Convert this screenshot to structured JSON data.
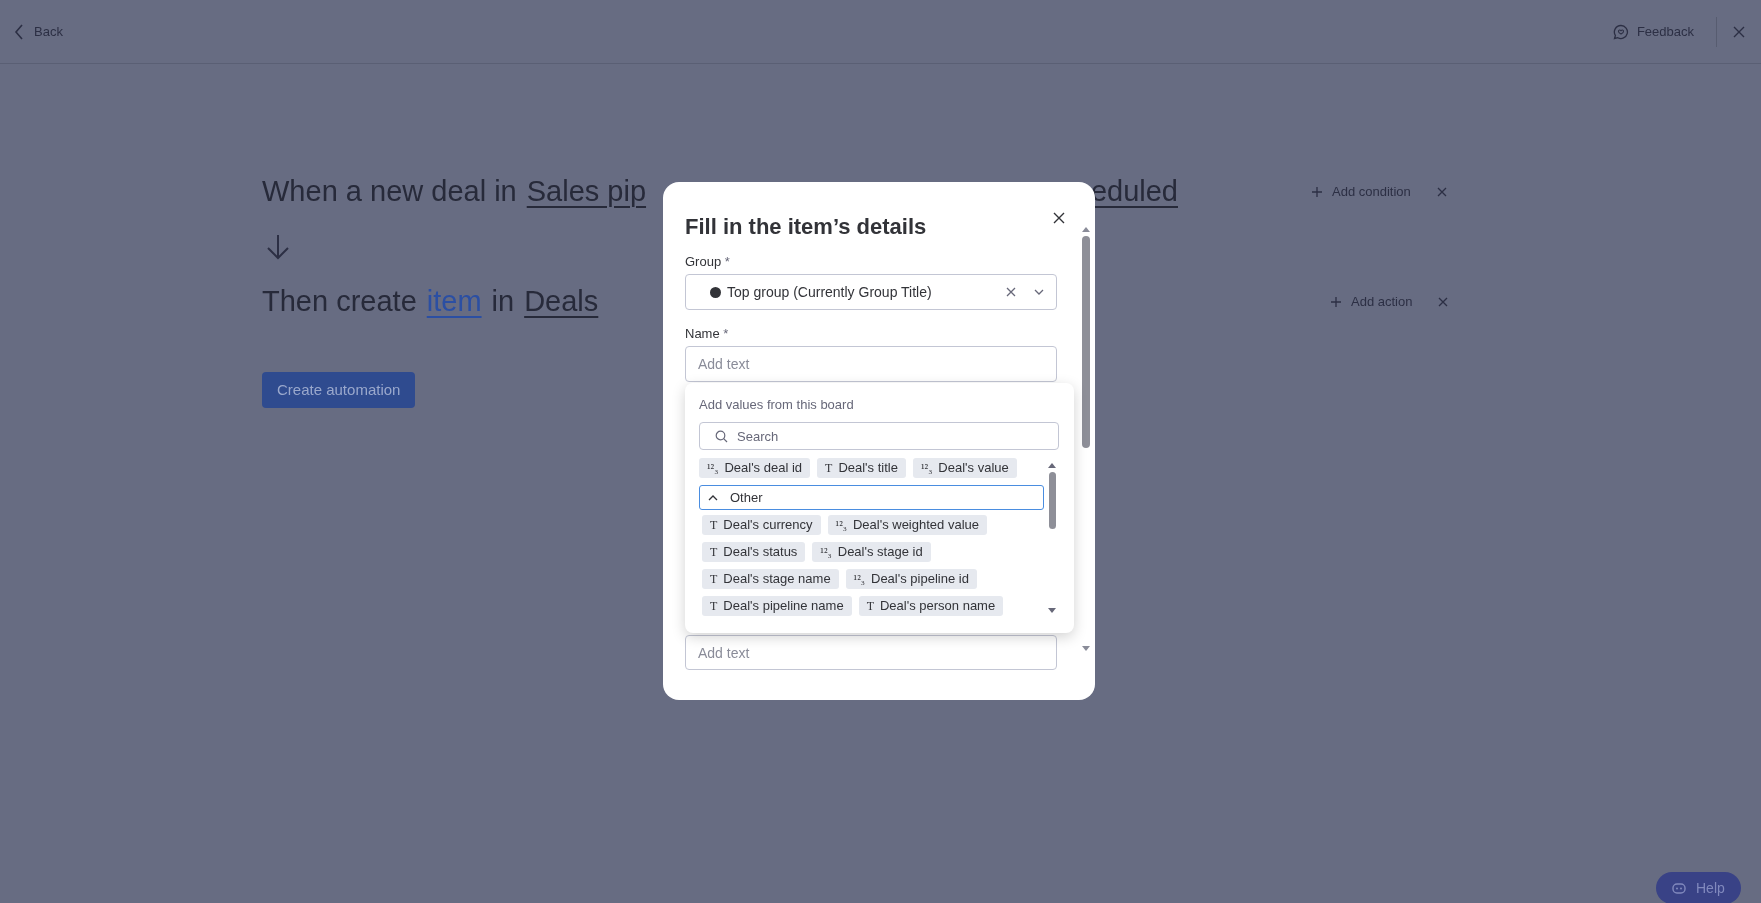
{
  "top_bar": {
    "back": "Back",
    "feedback": "Feedback"
  },
  "trigger": {
    "parts": [
      {
        "text": "When a new deal in",
        "kind": "plain"
      },
      {
        "text": "Sales pip",
        "kind": "field"
      },
      {
        "text": "eduled",
        "kind": "field"
      }
    ],
    "add": "Add condition"
  },
  "action": {
    "parts": [
      {
        "text": "Then create",
        "kind": "plain"
      },
      {
        "text": "item",
        "kind": "link"
      },
      {
        "text": "in",
        "kind": "plain"
      },
      {
        "text": "Deals",
        "kind": "field"
      }
    ],
    "add": "Add action"
  },
  "create_button": "Create automation",
  "modal": {
    "title": "Fill in the item’s details",
    "group": {
      "label": "Group",
      "required_mark": "*",
      "value": "Top group (Currently Group Title)"
    },
    "name": {
      "label": "Name",
      "required_mark": "*",
      "placeholder": "Add text"
    },
    "popover": {
      "heading": "Add values from this board",
      "search_placeholder": "Search",
      "chips": [
        {
          "icon": "¹²₃",
          "label": "Deal's deal id"
        },
        {
          "icon": "T",
          "label": "Deal's title"
        },
        {
          "icon": "¹²₃",
          "label": "Deal's value"
        }
      ],
      "section": {
        "label": "Other",
        "expanded": true,
        "chips": [
          {
            "icon": "T",
            "label": "Deal's currency"
          },
          {
            "icon": "¹²₃",
            "label": "Deal's weighted value"
          },
          {
            "icon": "T",
            "label": "Deal's status"
          },
          {
            "icon": "¹²₃",
            "label": "Deal's stage id"
          },
          {
            "icon": "T",
            "label": "Deal's stage name"
          },
          {
            "icon": "¹²₃",
            "label": "Deal's pipeline id"
          },
          {
            "icon": "T",
            "label": "Deal's pipeline name"
          },
          {
            "icon": "T",
            "label": "Deal's person name"
          }
        ]
      }
    },
    "extra_field": {
      "placeholder": "Add text"
    }
  },
  "help": "Help"
}
